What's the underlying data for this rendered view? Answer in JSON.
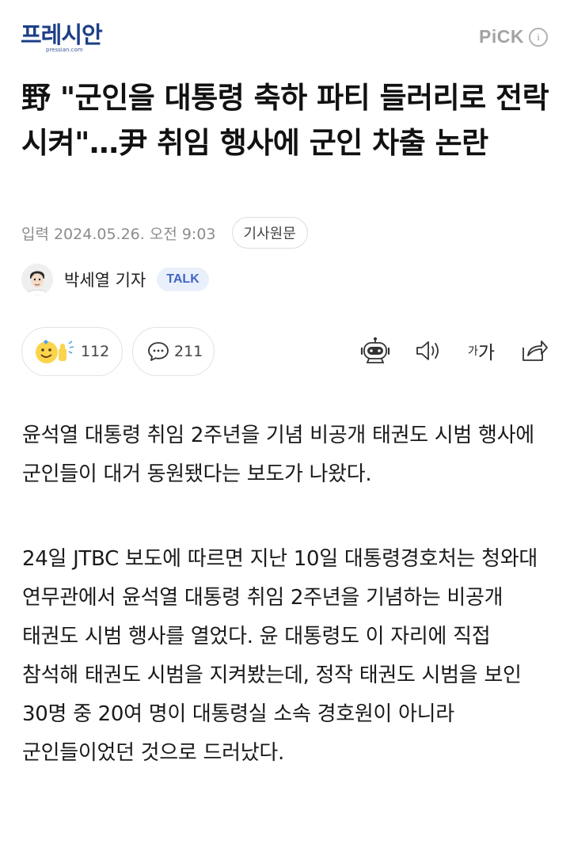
{
  "header": {
    "logo_text": "프레시안",
    "logo_sub": "pressian.com",
    "pick_label": "PiCK",
    "info_glyph": "i"
  },
  "article": {
    "headline": "野 \"군인을 대통령 축하 파티 들러리로 전락시켜\"…尹 취임 행사에 군인 차출 논란",
    "date_prefix": "입력",
    "date": "2024.05.26. 오전 9:03",
    "origin_label": "기사원문",
    "reporter": "박세열 기자",
    "talk_label": "TALK",
    "reaction_count": "112",
    "comment_count": "211",
    "font_icon_small": "가",
    "font_icon_large": "가",
    "paragraphs": [
      "윤석열 대통령 취임 2주년을 기념 비공개 태권도 시범 행사에 군인들이 대거 동원됐다는 보도가 나왔다.",
      "24일 JTBC 보도에 따르면 지난 10일 대통령경호처는 청와대 연무관에서 윤석열 대통령 취임 2주년을 기념하는 비공개 태권도 시범 행사를 열었다. 윤 대통령도 이 자리에 직접 참석해 태권도 시범을 지켜봤는데, 정작 태권도 시범을 보인 30명 중 20여 명이 대통령실 소속 경호원이 아니라 군인들이었던 것으로 드러났다."
    ]
  },
  "icons": {
    "reaction": "emoji-thumbs-icon",
    "comment": "comment-bubble-icon",
    "tts_robot": "robot-icon",
    "speaker": "speaker-icon",
    "font_size": "font-size-icon",
    "share": "share-icon"
  },
  "colors": {
    "brand": "#1d3f86",
    "talk_accent": "#3f66c6",
    "muted": "#8c8c8c"
  }
}
